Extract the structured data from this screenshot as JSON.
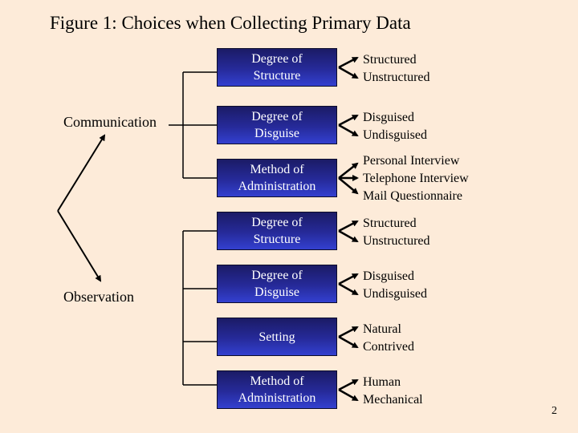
{
  "title": "Figure 1: Choices when Collecting Primary Data",
  "roots": [
    {
      "label": "Communication"
    },
    {
      "label": "Observation"
    }
  ],
  "communication": [
    {
      "box": "Degree of\nStructure",
      "options": [
        "Structured",
        "Unstructured"
      ]
    },
    {
      "box": "Degree of\nDisguise",
      "options": [
        "Disguised",
        "Undisguised"
      ]
    },
    {
      "box": "Method of\nAdministration",
      "options": [
        "Personal Interview",
        "Telephone Interview",
        "Mail Questionnaire"
      ]
    }
  ],
  "observation": [
    {
      "box": "Degree of\nStructure",
      "options": [
        "Structured",
        "Unstructured"
      ]
    },
    {
      "box": "Degree of\nDisguise",
      "options": [
        "Disguised",
        "Undisguised"
      ]
    },
    {
      "box": "Setting",
      "options": [
        "Natural",
        "Contrived"
      ]
    },
    {
      "box": "Method of\nAdministration",
      "options": [
        "Human",
        "Mechanical"
      ]
    }
  ],
  "page_number": "2"
}
